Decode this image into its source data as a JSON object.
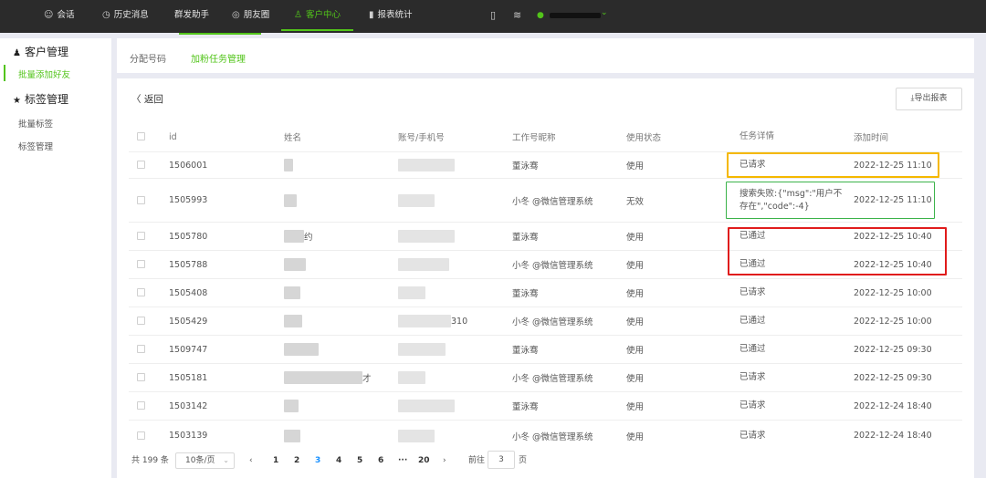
{
  "topnav": {
    "items": [
      {
        "icon": "chat-icon",
        "glyph": "☺",
        "label": "会话"
      },
      {
        "icon": "clock-icon",
        "glyph": "◷",
        "label": "历史消息"
      },
      {
        "icon": "",
        "glyph": "",
        "label": "群发助手"
      },
      {
        "icon": "moments-icon",
        "glyph": "◎",
        "label": "朋友圈"
      },
      {
        "icon": "user-icon",
        "glyph": "♙",
        "label": "客户中心"
      },
      {
        "icon": "bar-chart-icon",
        "glyph": "▮",
        "label": "报表统计"
      }
    ],
    "active_index": 4,
    "accent": "#52c41a",
    "book_glyph": "▯",
    "db_glyph": "≋",
    "user_glyph": "●",
    "chev_glyph": "⌄"
  },
  "sidebar": {
    "group1": {
      "glyph": "♟",
      "label": "客户管理"
    },
    "group1_items": [
      "批量添加好友"
    ],
    "group2": {
      "glyph": "★",
      "label": "标签管理"
    },
    "group2_items": [
      "批量标签",
      "标签管理"
    ]
  },
  "tabs": {
    "items": [
      "分配号码",
      "加粉任务管理"
    ],
    "active_index": 1
  },
  "toolbar": {
    "back_label": "〈 返回",
    "export_label": "⤓导出报表"
  },
  "table": {
    "headers": {
      "id": "id",
      "name": "姓名",
      "account": "账号/手机号",
      "work_name": "工作号昵称",
      "status": "使用状态",
      "detail": "任务详情",
      "time": "添加时间"
    },
    "rows": [
      {
        "id": "1506001",
        "name_suffix": "",
        "account_suffix": "",
        "work_name": "董泳骞",
        "status": "使用",
        "detail": "已请求",
        "time": "2022-12-25 11:10"
      },
      {
        "id": "1505993",
        "name_suffix": "",
        "account_suffix": "",
        "work_name": "小冬 @微信管理系统",
        "status": "无效",
        "detail": "搜索失败:{\"msg\":\"用户不存在\",\"code\":-4}",
        "time": "2022-12-25 11:10"
      },
      {
        "id": "1505780",
        "name_suffix": "约",
        "account_suffix": "",
        "work_name": "董泳骞",
        "status": "使用",
        "detail": "已通过",
        "time": "2022-12-25 10:40"
      },
      {
        "id": "1505788",
        "name_suffix": "",
        "account_suffix": "",
        "work_name": "小冬 @微信管理系统",
        "status": "使用",
        "detail": "已通过",
        "time": "2022-12-25 10:40"
      },
      {
        "id": "1505408",
        "name_suffix": "",
        "account_suffix": "",
        "work_name": "董泳骞",
        "status": "使用",
        "detail": "已请求",
        "time": "2022-12-25 10:00"
      },
      {
        "id": "1505429",
        "name_suffix": "",
        "account_suffix": "310",
        "work_name": "小冬 @微信管理系统",
        "status": "使用",
        "detail": "已通过",
        "time": "2022-12-25 10:00"
      },
      {
        "id": "1509747",
        "name_suffix": "",
        "account_suffix": "",
        "work_name": "董泳骞",
        "status": "使用",
        "detail": "已通过",
        "time": "2022-12-25 09:30"
      },
      {
        "id": "1505181",
        "name_suffix": "才",
        "account_suffix": "",
        "work_name": "小冬 @微信管理系统",
        "status": "使用",
        "detail": "已请求",
        "time": "2022-12-25 09:30"
      },
      {
        "id": "1503142",
        "name_suffix": "",
        "account_suffix": "",
        "work_name": "董泳骞",
        "status": "使用",
        "detail": "已请求",
        "time": "2022-12-24 18:40"
      },
      {
        "id": "1503139",
        "name_suffix": "",
        "account_suffix": "",
        "work_name": "小冬 @微信管理系统",
        "status": "使用",
        "detail": "已请求",
        "time": "2022-12-24 18:40"
      }
    ]
  },
  "highlight_colors": {
    "yellow": "#f5b800",
    "green": "#3bb34a",
    "red": "#e01c1c"
  },
  "pagination": {
    "total": "共 199 条",
    "page_size": "10条/页",
    "prev": "‹",
    "pages": [
      "1",
      "2",
      "3",
      "4",
      "5",
      "6"
    ],
    "ellipsis": "···",
    "last": "20",
    "next": "›",
    "active_page": "3",
    "goto_prefix": "前往",
    "goto_value": "3",
    "goto_suffix": "页"
  }
}
